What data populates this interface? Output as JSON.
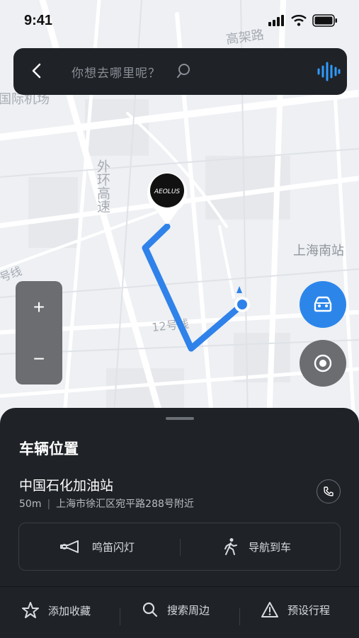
{
  "status_bar": {
    "time": "9:41"
  },
  "search": {
    "placeholder": "你想去哪里呢？"
  },
  "map": {
    "labels": {
      "viaduct": "高架路",
      "airport": "国际机场",
      "outer_ring": "外环高速",
      "south_station": "上海南站",
      "metro_line_12": "12号线",
      "line_partial": "号线"
    },
    "marker_logo": "AEOLUS",
    "zoom_in": "+",
    "zoom_out": "−",
    "colors": {
      "route": "#2f82ea",
      "accent": "#2c86ea"
    }
  },
  "sheet": {
    "title": "车辆位置",
    "poi_name": "中国石化加油站",
    "distance": "50m",
    "address": "上海市徐汇区宛平路288号附近",
    "actions": [
      {
        "label": "鸣笛闪灯",
        "icon": "horn-icon"
      },
      {
        "label": "导航到车",
        "icon": "walk-icon"
      }
    ]
  },
  "bottom_bar": [
    {
      "label": "添加收藏",
      "icon": "star-icon"
    },
    {
      "label": "搜索周边",
      "icon": "search-icon"
    },
    {
      "label": "预设行程",
      "icon": "warning-icon"
    }
  ]
}
